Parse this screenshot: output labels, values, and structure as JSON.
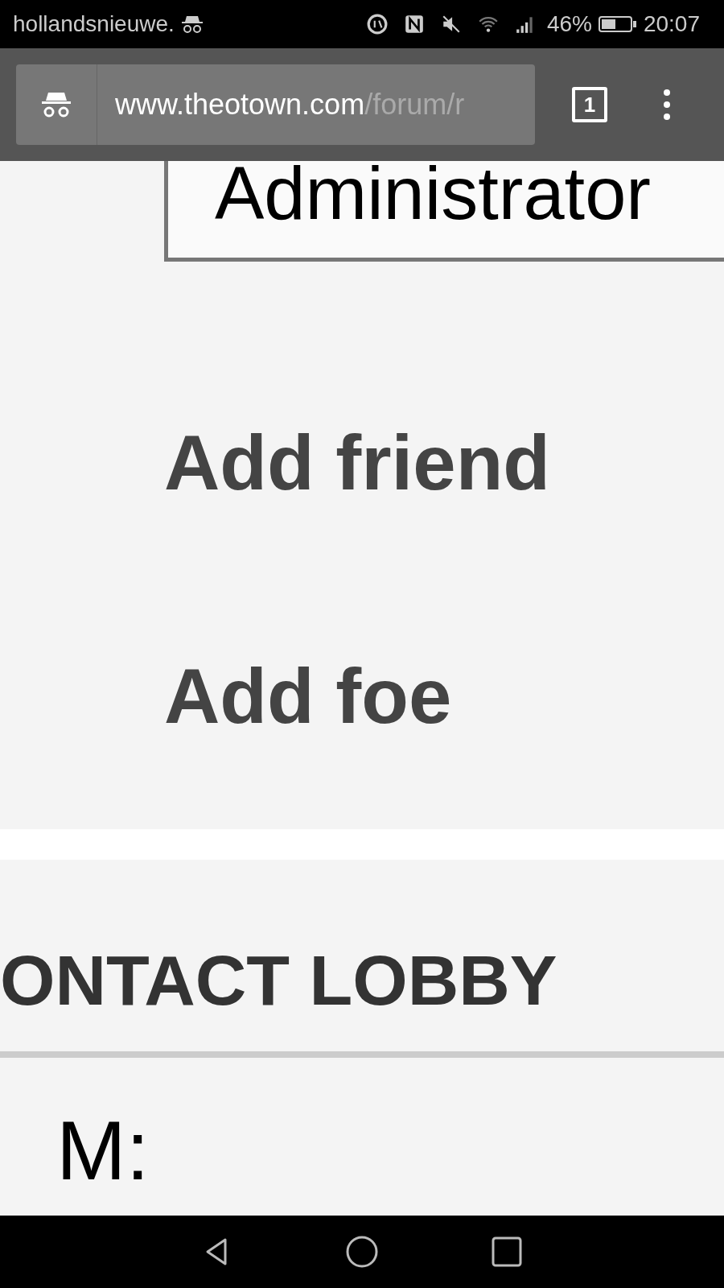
{
  "status_bar": {
    "notification": "hollandsnieuwe.",
    "battery": "46%",
    "time": "20:07"
  },
  "toolbar": {
    "url_host": "www.theotown.com",
    "url_path": "/forum/r",
    "tab_count": "1"
  },
  "profile": {
    "rank_label": "Administrator",
    "actions": [
      "Add friend",
      "Add foe"
    ]
  },
  "contact": {
    "heading": "ONTACT LOBBY",
    "field_label": "M:"
  }
}
